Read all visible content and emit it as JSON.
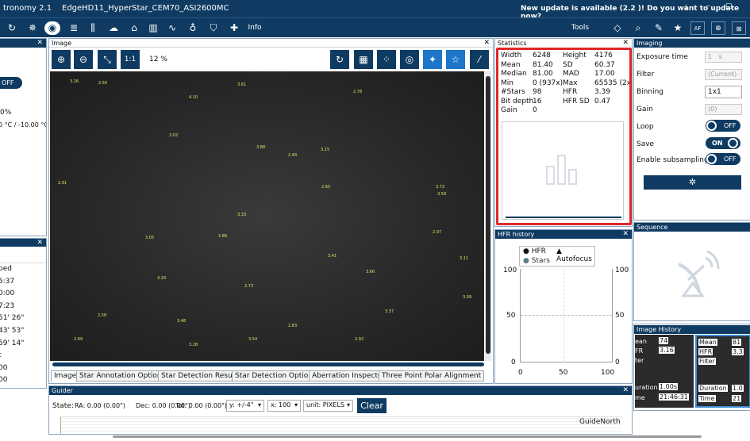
{
  "title": {
    "app": "tronomy 2.1",
    "profile": "EdgeHD11_HyperStar_CEM70_ASI2600MC",
    "update_notice": "New update is available (2.2 )! Do you want to update now?"
  },
  "toolbar": {
    "info_label": "Info",
    "tools_label": "Tools",
    "colors": {
      "accent": "#0f3b62",
      "button_on": "#1e76c8"
    }
  },
  "left_panel": {
    "toggle": "OFF",
    "pct": "0%",
    "temp": "0 °C / -10.00 °C",
    "list": [
      "ped",
      "5:37",
      "0:00",
      "7:23",
      "51' 26\"",
      "43' 53\"",
      "59' 14\"",
      "t",
      "00",
      "00"
    ]
  },
  "image": {
    "title": "Image",
    "zoom_ratio": "1:1",
    "zoom": "12 %",
    "tabs": [
      "Image",
      "Star Annotation Options",
      "Star Detection Results",
      "Star Detection Options",
      "Aberration Inspector",
      "Three Point Polar Alignment"
    ],
    "star_labels": [
      "3.26",
      "2.50",
      "4.10",
      "3.61",
      "2.78",
      "3.02",
      "3.88",
      "2.44",
      "3.15",
      "3.59",
      "2.91",
      "3.33",
      "2.65",
      "3.72",
      "3.05",
      "2.86",
      "3.41",
      "2.97",
      "3.20",
      "2.73",
      "3.66",
      "3.11",
      "2.58",
      "3.48",
      "2.83",
      "3.37",
      "3.09",
      "2.69",
      "3.54",
      "3.28",
      "2.92"
    ]
  },
  "statistics": {
    "title": "Statistics",
    "rows": [
      {
        "l1": "Width",
        "v1": "6248",
        "l2": "Height",
        "v2": "4176"
      },
      {
        "l1": "Mean",
        "v1": "81.40",
        "l2": "SD",
        "v2": "60.37"
      },
      {
        "l1": "Median",
        "v1": "81.00",
        "l2": "MAD",
        "v2": "17.00"
      },
      {
        "l1": "Min",
        "v1": "0 (937x)",
        "l2": "Max",
        "v2": "65535 (2x"
      },
      {
        "l1": "#Stars",
        "v1": "98",
        "l2": "HFR",
        "v2": "3.39"
      },
      {
        "l1": "Bit depth",
        "v1": "16",
        "l2": "HFR SD",
        "v2": "0.47"
      },
      {
        "l1": "Gain",
        "v1": "0",
        "l2": "",
        "v2": ""
      }
    ],
    "highlight_color": "#e02828"
  },
  "hfr": {
    "title": "HFR history",
    "legend": [
      "HFR",
      "Autofocus",
      "Stars"
    ],
    "y_ticks": [
      "100",
      "50",
      "0"
    ],
    "y2_ticks": [
      "100",
      "50",
      "0"
    ],
    "x_ticks": [
      "0",
      "50",
      "100"
    ]
  },
  "imaging": {
    "title": "Imaging",
    "exposure_label": "Exposure time",
    "exposure_value": "1",
    "exposure_unit": "s",
    "filter_label": "Filter",
    "filter_value": "(Current)",
    "binning_label": "Binning",
    "binning_value": "1x1",
    "gain_label": "Gain",
    "gain_value": "(0)",
    "loop_label": "Loop",
    "loop_value": "OFF",
    "save_label": "Save",
    "save_value": "ON",
    "subsampling_label": "Enable subsampling",
    "subsampling_value": "OFF"
  },
  "sequence": {
    "title": "Sequence"
  },
  "history": {
    "title": "Image History",
    "card1": {
      "mean": "74",
      "hfr": "3.16",
      "duration": "1.00s",
      "time": "21:46:31"
    },
    "card2": {
      "mean_label": "Mean",
      "mean": "81",
      "hfr_label": "HFR",
      "hfr": "3.3",
      "filter_label": "Filter",
      "duration_label": "Duration",
      "duration": "1.0",
      "time_label": "Time",
      "time": "21"
    },
    "card1_labels": {
      "mean": "ean",
      "hfr": "FR",
      "filter": "ter",
      "duration": "uration",
      "time": "me"
    }
  },
  "guider": {
    "title": "Guider",
    "state": "State:",
    "ra": "RA: 0.00 (0.00\")",
    "dec": "Dec: 0.00 (0.00\")",
    "tot": "Tot: 0.00 (0.00\")",
    "y_select": "y: +/-4\"",
    "x_select": "x: 100",
    "unit_select": "unit: PIXELS",
    "clear_label": "Clear",
    "direction": "GuideNorth"
  }
}
